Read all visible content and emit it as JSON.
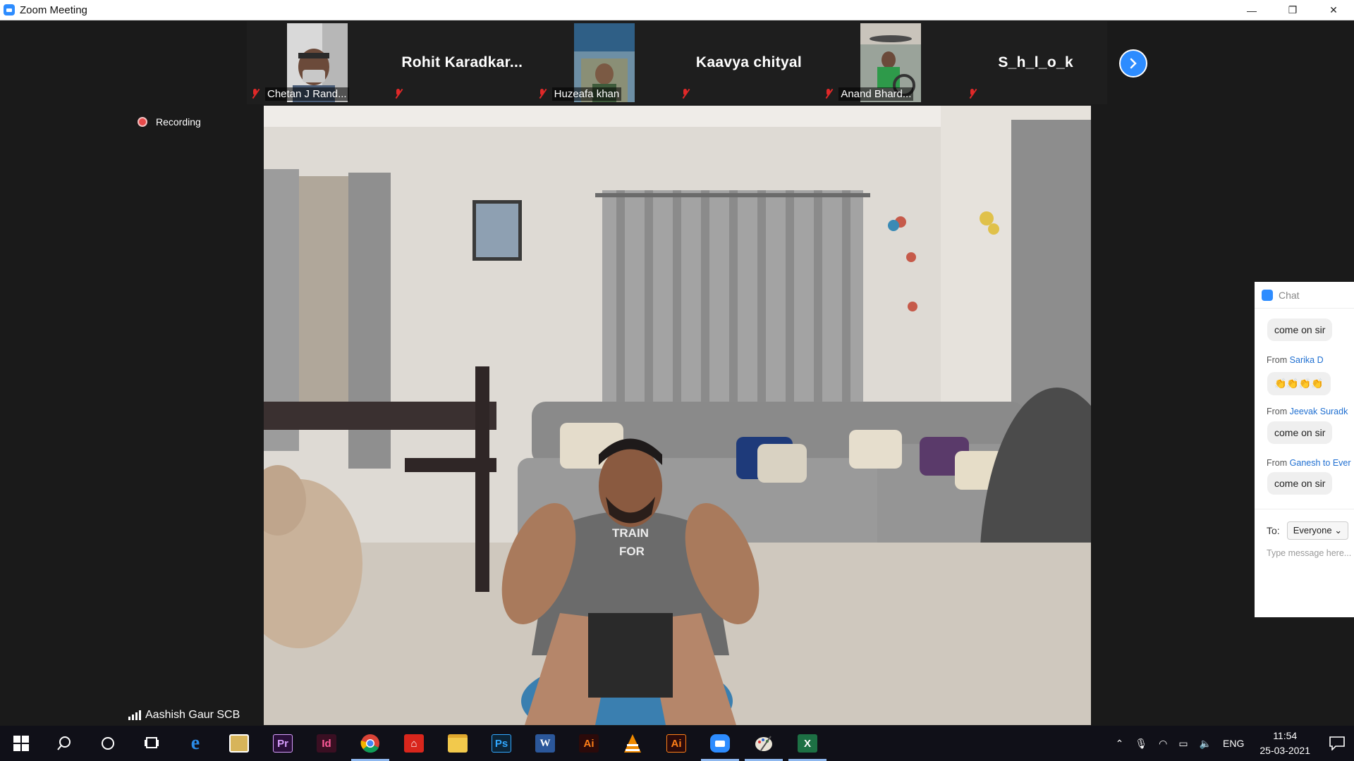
{
  "window": {
    "title": "Zoom Meeting",
    "minimize": "—",
    "maximize": "❐",
    "close": "✕"
  },
  "participants": [
    {
      "name": "Chetan J Rand...",
      "has_video": true
    },
    {
      "name": "Rohit  Karadkar...",
      "has_video": false
    },
    {
      "name": "Huzeafa khan",
      "has_video": true
    },
    {
      "name": "Kaavya chityal",
      "has_video": false
    },
    {
      "name": "Anand Bhard...",
      "has_video": true
    },
    {
      "name": "S_h_l_o_k",
      "has_video": false
    }
  ],
  "recording": {
    "label": "Recording"
  },
  "main_video": {
    "speaker": "Aashish Gaur SCB",
    "shirt_line1": "TRAIN",
    "shirt_line2": "FOR"
  },
  "chat": {
    "title": "Chat",
    "messages": [
      {
        "from_prefix": "",
        "from": "",
        "to": "",
        "text": "come on sir"
      },
      {
        "from_prefix": "From",
        "from": "Sarika",
        "to": "D",
        "text": "👏👏👏👏"
      },
      {
        "from_prefix": "From",
        "from": "Jeevak  Suradk",
        "to": "",
        "text": "come on sir"
      },
      {
        "from_prefix": "From",
        "from": "Ganesh",
        "to": "to Ever",
        "text": "come on sir"
      }
    ],
    "to_label": "To:",
    "to_value": "Everyone",
    "input_placeholder": "Type message here..."
  },
  "taskbar": {
    "apps": [
      {
        "name": "start",
        "label": ""
      },
      {
        "name": "search",
        "label": ""
      },
      {
        "name": "cortana",
        "label": ""
      },
      {
        "name": "task-view",
        "label": ""
      },
      {
        "name": "edge",
        "label": "e"
      },
      {
        "name": "photos",
        "label": ""
      },
      {
        "name": "premiere",
        "label": "Pr"
      },
      {
        "name": "indesign",
        "label": "Id"
      },
      {
        "name": "chrome",
        "label": ""
      },
      {
        "name": "acrobat",
        "label": ""
      },
      {
        "name": "explorer",
        "label": ""
      },
      {
        "name": "photoshop",
        "label": "Ps"
      },
      {
        "name": "word",
        "label": "W"
      },
      {
        "name": "illustrator",
        "label": "Ai"
      },
      {
        "name": "vlc",
        "label": ""
      },
      {
        "name": "illustrator-2",
        "label": "Ai"
      },
      {
        "name": "zoom",
        "label": ""
      },
      {
        "name": "paint",
        "label": ""
      },
      {
        "name": "excel",
        "label": "X"
      }
    ],
    "tray": {
      "language": "ENG",
      "time": "11:54",
      "date": "25-03-2021"
    }
  }
}
